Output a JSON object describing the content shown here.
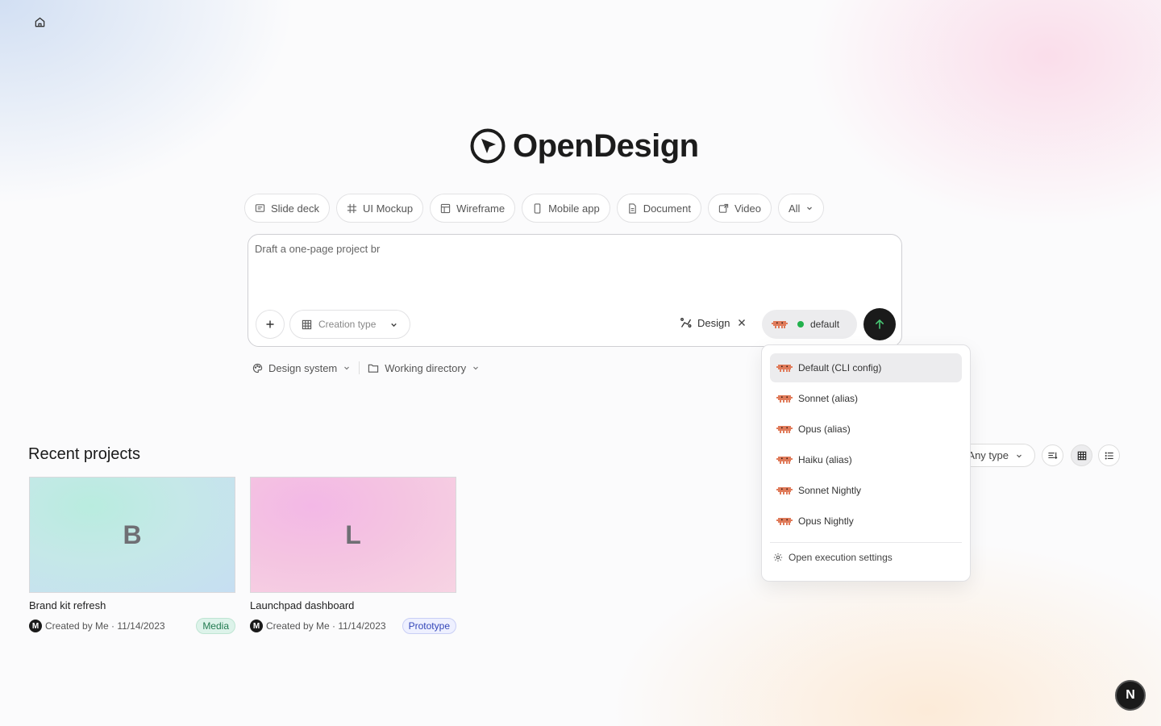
{
  "home": {
    "icon": "home-icon"
  },
  "logo": {
    "text": "OpenDesign",
    "icon": "open-design-logo-icon"
  },
  "chips": [
    {
      "label": "Slide deck",
      "icon": "slide-deck-icon"
    },
    {
      "label": "UI Mockup",
      "icon": "frame-icon"
    },
    {
      "label": "Wireframe",
      "icon": "wireframe-icon"
    },
    {
      "label": "Mobile app",
      "icon": "mobile-icon"
    },
    {
      "label": "Document",
      "icon": "document-icon"
    },
    {
      "label": "Video",
      "icon": "video-icon"
    },
    {
      "label": "All",
      "icon": "chevron-down-icon"
    }
  ],
  "composer": {
    "value": "Draft a one-page project br",
    "creation_type_label": "Creation type",
    "design_label": "Design",
    "model_label": "default"
  },
  "subrow": {
    "design_system_label": "Design system",
    "working_directory_label": "Working directory"
  },
  "recent": {
    "title": "Recent projects",
    "type_filter_label": "Any type",
    "projects": [
      {
        "initial": "B",
        "name": "Brand kit refresh",
        "avatar": "M",
        "meta": "Created by Me · 11/14/2023",
        "badge": "Media"
      },
      {
        "initial": "L",
        "name": "Launchpad dashboard",
        "avatar": "M",
        "meta": "Created by Me · 11/14/2023",
        "badge": "Prototype"
      }
    ]
  },
  "model_menu": {
    "items": [
      {
        "label": "Default (CLI config)",
        "selected": true
      },
      {
        "label": "Sonnet (alias)",
        "selected": false
      },
      {
        "label": "Opus (alias)",
        "selected": false
      },
      {
        "label": "Haiku (alias)",
        "selected": false
      },
      {
        "label": "Sonnet Nightly",
        "selected": false
      },
      {
        "label": "Opus Nightly",
        "selected": false
      }
    ],
    "settings_label": "Open execution settings"
  },
  "fab": {
    "label": "N"
  },
  "colors": {
    "accent": "#1a1a1a",
    "status_ok": "#22b14c",
    "model_icon": "#e07b5a"
  }
}
